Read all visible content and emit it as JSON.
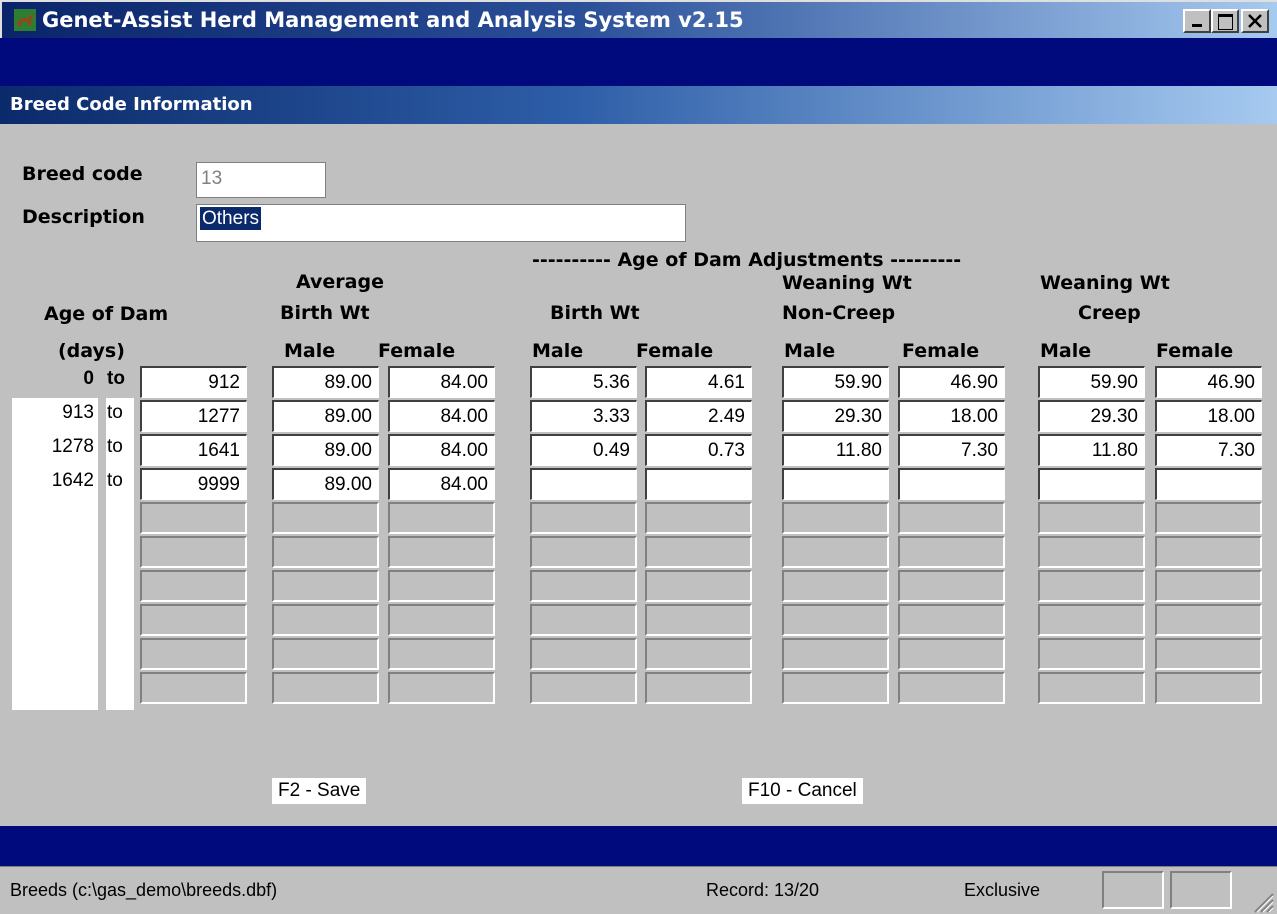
{
  "window": {
    "title": "Genet-Assist Herd Management and Analysis System v2.15",
    "min_glyph": "_",
    "max_glyph": "□",
    "close_glyph": "✕"
  },
  "panel": {
    "title": "Breed Code Information"
  },
  "form": {
    "breed_code_label": "Breed code",
    "breed_code_value": "13",
    "description_label": "Description",
    "description_value": "Others"
  },
  "headers": {
    "age_of_dam": "Age of Dam",
    "days": "(days)",
    "average": "Average",
    "birth_wt_avg": "Birth Wt",
    "adjustments_banner": "---------- Age of Dam Adjustments ---------",
    "birth_wt": "Birth Wt",
    "weaning_wt_noncreep_1": "Weaning Wt",
    "weaning_wt_noncreep_2": "Non-Creep",
    "weaning_wt_creep_1": "Weaning Wt",
    "weaning_wt_creep_2": "Creep",
    "male": "Male",
    "female": "Female"
  },
  "rows": [
    {
      "from": "0",
      "to_label": "to",
      "to": "912",
      "avg_male": "89.00",
      "avg_female": "84.00",
      "bw_male": "5.36",
      "bw_female": "4.61",
      "nc_male": "59.90",
      "nc_female": "46.90",
      "cr_male": "59.90",
      "cr_female": "46.90"
    },
    {
      "from": "913",
      "to_label": "to",
      "to": "1277",
      "avg_male": "89.00",
      "avg_female": "84.00",
      "bw_male": "3.33",
      "bw_female": "2.49",
      "nc_male": "29.30",
      "nc_female": "18.00",
      "cr_male": "29.30",
      "cr_female": "18.00"
    },
    {
      "from": "1278",
      "to_label": "to",
      "to": "1641",
      "avg_male": "89.00",
      "avg_female": "84.00",
      "bw_male": "0.49",
      "bw_female": "0.73",
      "nc_male": "11.80",
      "nc_female": "7.30",
      "cr_male": "11.80",
      "cr_female": "7.30"
    },
    {
      "from": "1642",
      "to_label": "to",
      "to": "9999",
      "avg_male": "89.00",
      "avg_female": "84.00",
      "bw_male": "",
      "bw_female": "",
      "nc_male": "",
      "nc_female": "",
      "cr_male": "",
      "cr_female": ""
    }
  ],
  "buttons": {
    "save": "F2 - Save",
    "cancel": "F10 - Cancel"
  },
  "status": {
    "file": "Breeds (c:\\gas_demo\\breeds.dbf)",
    "record": "Record: 13/20",
    "mode": "Exclusive"
  },
  "colors": {
    "title_bar": "#0a246a",
    "dark_band": "#000a7c",
    "window_bg": "#c0c0c0",
    "selection": "#0b2a6b"
  }
}
